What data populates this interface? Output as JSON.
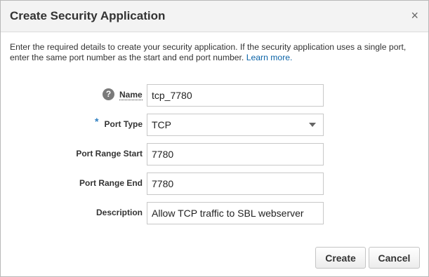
{
  "dialog": {
    "title": "Create Security Application",
    "close_glyph": "×",
    "intro_text": "Enter the required details to create your security application. If the security application uses a single port, enter the same port number as the start and end port number.",
    "learn_more": "Learn more."
  },
  "form": {
    "name": {
      "label": "Name",
      "value": "tcp_7780",
      "help_icon": "?"
    },
    "port_type": {
      "label": "Port Type",
      "required_marker": "*",
      "value": "TCP"
    },
    "port_range_start": {
      "label": "Port Range Start",
      "value": "7780"
    },
    "port_range_end": {
      "label": "Port Range End",
      "value": "7780"
    },
    "description": {
      "label": "Description",
      "value": "Allow TCP traffic to SBL webserver"
    }
  },
  "buttons": {
    "create": "Create",
    "cancel": "Cancel"
  }
}
